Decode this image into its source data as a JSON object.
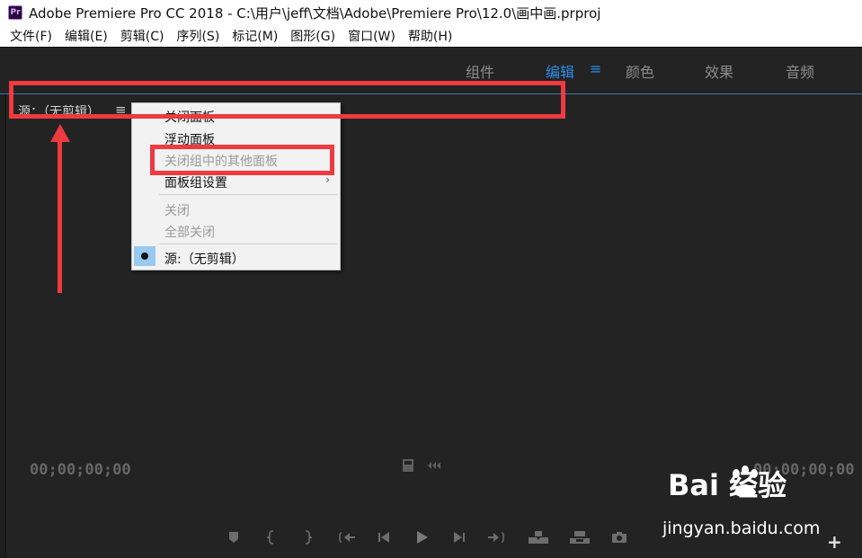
{
  "titlebar": {
    "app_icon": "Pr",
    "title": "Adobe Premiere Pro CC 2018 - C:\\用户\\jeff\\文档\\Adobe\\Premiere Pro\\12.0\\画中画.prproj"
  },
  "menubar": {
    "items": [
      "文件(F)",
      "编辑(E)",
      "剪辑(C)",
      "序列(S)",
      "标记(M)",
      "图形(G)",
      "窗口(W)",
      "帮助(H)"
    ]
  },
  "workspace": {
    "tabs": [
      "组件",
      "编辑",
      "颜色",
      "效果",
      "音频"
    ],
    "active": "编辑",
    "menu_icon": "≡"
  },
  "panel": {
    "header_label": "源：（无剪辑）",
    "menu_icon": "≡",
    "timecode_left": "00;00;00;00",
    "timecode_right": "00;00;00;00"
  },
  "context_menu": {
    "items": [
      "关闭面板",
      "浮动面板",
      "关闭组中的其他面板",
      "面板组设置",
      "关闭",
      "全部关闭",
      "源:（无剪辑）"
    ],
    "submenu_arrow": "›"
  },
  "transport": {
    "icons": [
      "marker-icon",
      "mark-in-icon",
      "mark-out-icon",
      "go-to-in-icon",
      "step-back-icon",
      "play-icon",
      "step-forward-icon",
      "go-to-out-icon",
      "insert-icon",
      "overwrite-icon",
      "export-frame-icon"
    ],
    "add_label": "+"
  },
  "watermark": {
    "logo": "Bai  经验",
    "url": "jingyan.baidu.com"
  },
  "colors": {
    "annotation": "#ef3a3f",
    "accent": "#2d8ceb",
    "background": "#232323"
  }
}
